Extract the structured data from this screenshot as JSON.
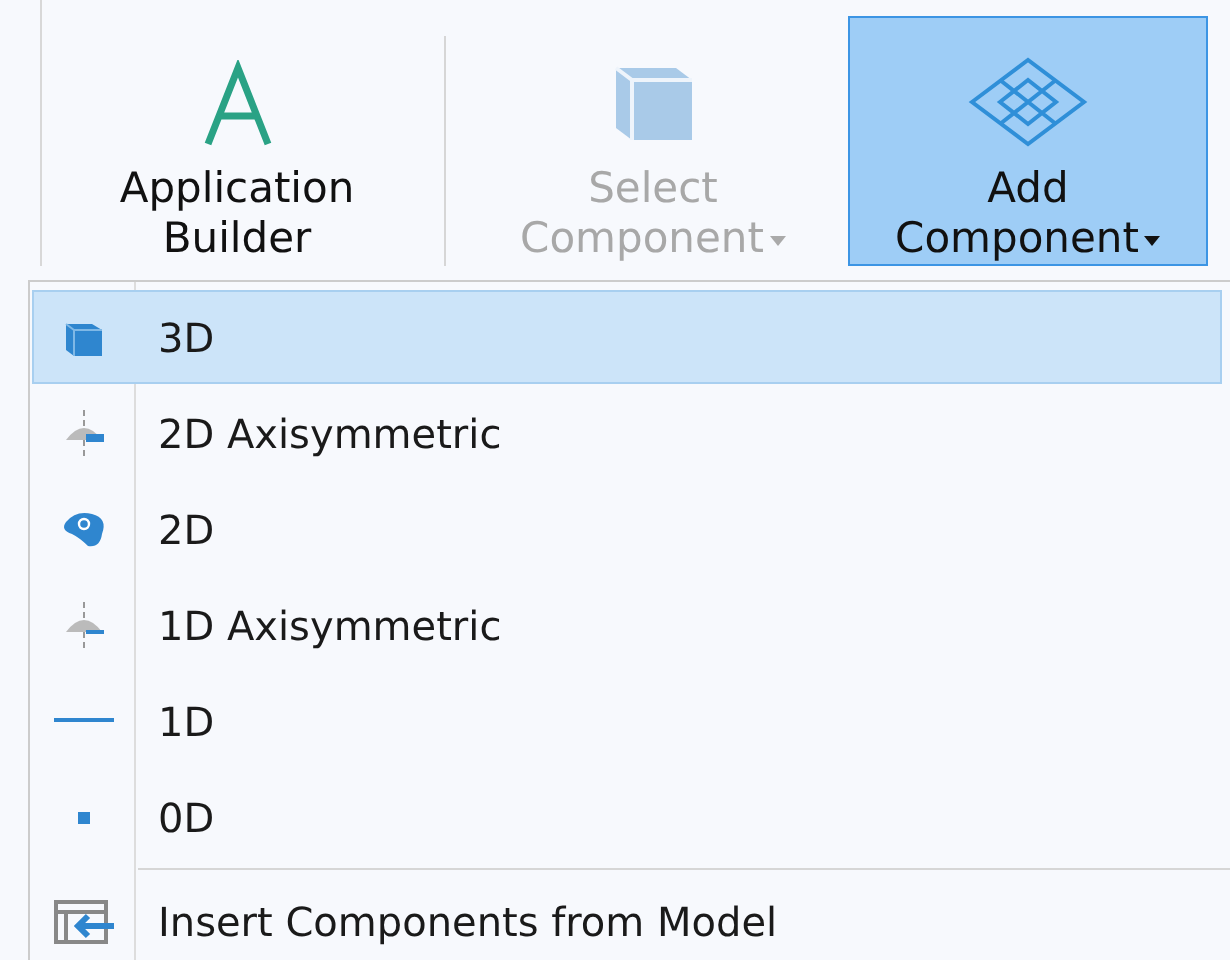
{
  "ribbon": {
    "buttons": [
      {
        "lines": [
          "Application",
          "Builder"
        ],
        "disabled": false,
        "selected": false,
        "dropdown": false
      },
      {
        "lines": [
          "Select",
          "Component"
        ],
        "disabled": true,
        "selected": false,
        "dropdown": true
      },
      {
        "lines": [
          "Add",
          "Component"
        ],
        "disabled": false,
        "selected": true,
        "dropdown": true
      }
    ]
  },
  "menu": {
    "sections": [
      [
        {
          "label": "3D",
          "selected": true
        },
        {
          "label": "2D Axisymmetric",
          "selected": false
        },
        {
          "label": "2D",
          "selected": false
        },
        {
          "label": "1D Axisymmetric",
          "selected": false
        },
        {
          "label": "1D",
          "selected": false
        },
        {
          "label": "0D",
          "selected": false
        }
      ],
      [
        {
          "label": "Insert Components from Model",
          "selected": false
        }
      ]
    ]
  }
}
